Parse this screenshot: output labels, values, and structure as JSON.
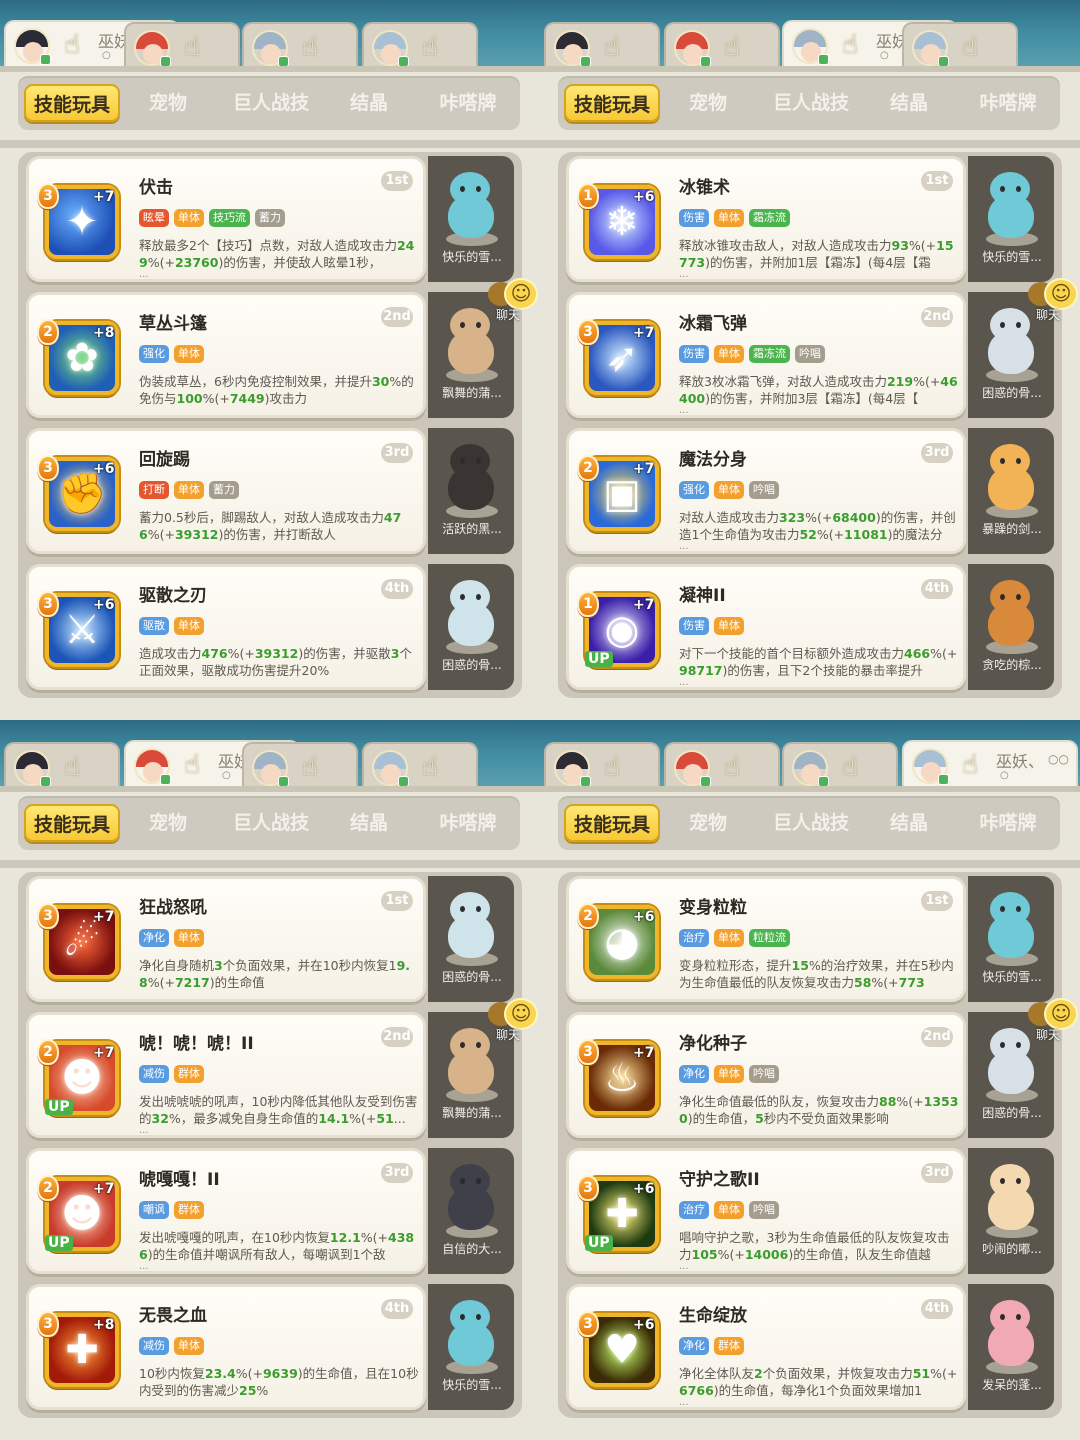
{
  "colors": {
    "tag_orange": "#f2a12f",
    "tag_green": "#4cb44f",
    "tag_blue": "#5a9be0",
    "tag_gray": "#a59d8e",
    "tag_red": "#e4572e",
    "highlight": "#3a9d2d",
    "nav_active": "#f7c935"
  },
  "panels": [
    {
      "active_tab": 0,
      "char_tabs": [
        {
          "name": "巫妖、",
          "dots": "○○",
          "sub": "○",
          "icon": "pointing-hand-icon"
        },
        {
          "name": "",
          "dots": "",
          "sub": "",
          "icon": "pointing-hand-icon"
        },
        {
          "name": "",
          "dots": "",
          "sub": "",
          "icon": "pointing-hand-icon"
        },
        {
          "name": "",
          "dots": "",
          "sub": "",
          "icon": "pointing-hand-icon"
        }
      ],
      "nav": [
        "技能玩具",
        "宠物",
        "巨人战技",
        "结晶",
        "咔嗒牌"
      ],
      "chat_label": "聊天",
      "cards": [
        {
          "title": "伏击",
          "rank": "1st",
          "level": "3",
          "plus": "+7",
          "up": "",
          "icon": "ambush-skill-icon",
          "tags": [
            [
              "眩晕",
              "red"
            ],
            [
              "单体",
              "orange"
            ],
            [
              "技巧流",
              "green"
            ],
            [
              "蓄力",
              "gray"
            ]
          ],
          "desc": [
            "释放最多2个【技巧】点数，对敌人造成攻击力",
            [
              "249",
              "%(+"
            ],
            [
              "23760",
              ")的伤害，并使敌人眩晕1秒，"
            ]
          ],
          "desc_plain": "",
          "more": "...",
          "pet": "快乐的雪..."
        },
        {
          "title": "草丛斗篷",
          "rank": "2nd",
          "level": "2",
          "plus": "+8",
          "up": "",
          "icon": "bush-cloak-skill-icon",
          "tags": [
            [
              "强化",
              "blue"
            ],
            [
              "单体",
              "orange"
            ]
          ],
          "desc": [
            "伪装成草丛，6秒内免疫控制效果，并提升",
            [
              "30",
              ""
            ],
            [
              "",
              "%的免伤与"
            ],
            [
              "100",
              "%(+"
            ],
            [
              "7449",
              ")攻击力"
            ]
          ],
          "more": "",
          "pet": "飘舞的蒲..."
        },
        {
          "title": "回旋踢",
          "rank": "3rd",
          "level": "3",
          "plus": "+6",
          "up": "",
          "icon": "spin-kick-skill-icon",
          "tags": [
            [
              "打断",
              "red"
            ],
            [
              "单体",
              "orange"
            ],
            [
              "蓄力",
              "gray"
            ]
          ],
          "desc": [
            "蓄力0.5秒后，脚踢敌人，对敌人造成攻击力",
            [
              "476",
              "%(+"
            ],
            [
              "39312",
              ")的伤害，并打断敌人"
            ]
          ],
          "more": "",
          "pet": "活跃的黑..."
        },
        {
          "title": "驱散之刃",
          "rank": "4th",
          "level": "3",
          "plus": "+6",
          "up": "",
          "icon": "dispel-blade-skill-icon",
          "tags": [
            [
              "驱散",
              "blue"
            ],
            [
              "单体",
              "orange"
            ]
          ],
          "desc": [
            "造成攻击力",
            [
              "476",
              "%(+"
            ],
            [
              "39312",
              ")的伤害，并驱散"
            ],
            [
              "3",
              "个正面效果，驱散成功伤害提升20%"
            ]
          ],
          "more": "",
          "pet": "困惑的骨..."
        }
      ]
    },
    {
      "active_tab": 2,
      "char_tabs": [
        {
          "name": "",
          "dots": "",
          "sub": "",
          "icon": "pointing-hand-icon"
        },
        {
          "name": "",
          "dots": "",
          "sub": "",
          "icon": "pointing-hand-icon"
        },
        {
          "name": "巫妖、",
          "dots": "○○",
          "sub": "○",
          "icon": "pointing-hand-icon"
        },
        {
          "name": "",
          "dots": "",
          "sub": "",
          "icon": "pointing-hand-icon"
        }
      ],
      "nav": [
        "技能玩具",
        "宠物",
        "巨人战技",
        "结晶",
        "咔嗒牌"
      ],
      "chat_label": "聊天",
      "cards": [
        {
          "title": "冰锥术",
          "rank": "1st",
          "level": "1",
          "plus": "+6",
          "up": "",
          "icon": "ice-cone-skill-icon",
          "tags": [
            [
              "伤害",
              "blue"
            ],
            [
              "单体",
              "orange"
            ],
            [
              "霜冻流",
              "green"
            ]
          ],
          "desc": [
            "释放冰锥攻击敌人，对敌人造成攻击力",
            [
              "93",
              "%(+"
            ],
            [
              "15773",
              ")的伤害，并附加1层【霜冻】(每4层【霜"
            ]
          ],
          "more": "...",
          "pet": "快乐的雪..."
        },
        {
          "title": "冰霜飞弹",
          "rank": "2nd",
          "level": "3",
          "plus": "+7",
          "up": "",
          "icon": "frost-missile-skill-icon",
          "tags": [
            [
              "伤害",
              "blue"
            ],
            [
              "单体",
              "orange"
            ],
            [
              "霜冻流",
              "green"
            ],
            [
              "吟唱",
              "gray"
            ]
          ],
          "desc": [
            "释放3枚冰霜飞弹，对敌人造成攻击力",
            [
              "219",
              "%(+"
            ],
            [
              "46400",
              ")的伤害，并附加3层【霜冻】(每4层【"
            ]
          ],
          "more": "...",
          "pet": "困惑的骨..."
        },
        {
          "title": "魔法分身",
          "rank": "3rd",
          "level": "2",
          "plus": "+7",
          "up": "",
          "icon": "magic-clone-skill-icon",
          "tags": [
            [
              "强化",
              "blue"
            ],
            [
              "单体",
              "orange"
            ],
            [
              "吟唱",
              "gray"
            ]
          ],
          "desc": [
            "对敌人造成攻击力",
            [
              "323",
              "%(+"
            ],
            [
              "68400",
              ")的伤害，并创造1个生命值为攻击力"
            ],
            [
              "52",
              "%(+"
            ],
            [
              "11081",
              ")的魔法分"
            ]
          ],
          "more": "...",
          "pet": "暴躁的剑..."
        },
        {
          "title": "凝神II",
          "rank": "4th",
          "level": "1",
          "plus": "+7",
          "up": "UP",
          "icon": "focus-skill-icon",
          "tags": [
            [
              "伤害",
              "blue"
            ],
            [
              "单体",
              "orange"
            ]
          ],
          "desc": [
            "对下一个技能的首个目标额外造成攻击力",
            [
              "466",
              "%(+"
            ],
            [
              "98717",
              ")的伤害，且下2个技能的暴击率提升"
            ]
          ],
          "more": "...",
          "pet": "贪吃的棕..."
        }
      ]
    },
    {
      "active_tab": 1,
      "char_tabs": [
        {
          "name": "",
          "dots": "",
          "sub": "",
          "icon": "pointing-hand-icon"
        },
        {
          "name": "巫妖、",
          "dots": "○○",
          "sub": "○",
          "icon": "pointing-hand-icon"
        },
        {
          "name": "",
          "dots": "",
          "sub": "",
          "icon": "pointing-hand-icon"
        },
        {
          "name": "",
          "dots": "",
          "sub": "",
          "icon": "pointing-hand-icon"
        }
      ],
      "nav": [
        "技能玩具",
        "宠物",
        "巨人战技",
        "结晶",
        "咔嗒牌"
      ],
      "chat_label": "聊天",
      "cards": [
        {
          "title": "狂战怒吼",
          "rank": "1st",
          "level": "3",
          "plus": "+7",
          "up": "",
          "icon": "berserk-roar-skill-icon",
          "tags": [
            [
              "净化",
              "blue"
            ],
            [
              "单体",
              "orange"
            ]
          ],
          "desc": [
            "净化自身随机",
            [
              "3",
              "个负面效果，并在10秒内恢复1"
            ],
            [
              "9.8",
              "%(+"
            ],
            [
              "7217",
              ")的生命值"
            ]
          ],
          "more": "",
          "pet": "困惑的骨..."
        },
        {
          "title": "唬！唬！唬！II",
          "rank": "2nd",
          "level": "2",
          "plus": "+7",
          "up": "UP",
          "icon": "roar-skill-icon",
          "tags": [
            [
              "减伤",
              "blue"
            ],
            [
              "群体",
              "orange"
            ]
          ],
          "desc": [
            "发出唬唬唬的吼声，10秒内降低其他队友受到伤害的",
            [
              "32",
              "%，最多减免自身生命值的"
            ],
            [
              "14.1",
              "%(+"
            ],
            [
              "51",
              "..."
            ]
          ],
          "more": "...",
          "pet": "飘舞的蒲..."
        },
        {
          "title": "唬嘎嘎！II",
          "rank": "3rd",
          "level": "2",
          "plus": "+7",
          "up": "UP",
          "icon": "taunt-roar-skill-icon",
          "tags": [
            [
              "嘲讽",
              "blue"
            ],
            [
              "群体",
              "orange"
            ]
          ],
          "desc": [
            "发出唬嘎嘎的吼声，在10秒内恢复",
            [
              "12.1",
              "%(+"
            ],
            [
              "4386",
              ")的生命值并嘲讽所有敌人，每嘲讽到1个敌"
            ]
          ],
          "more": "...",
          "pet": "自信的大..."
        },
        {
          "title": "无畏之血",
          "rank": "4th",
          "level": "3",
          "plus": "+8",
          "up": "",
          "icon": "fearless-blood-skill-icon",
          "tags": [
            [
              "减伤",
              "blue"
            ],
            [
              "单体",
              "orange"
            ]
          ],
          "desc": [
            "10秒内恢复",
            [
              "23.4",
              "%(+"
            ],
            [
              "9639",
              ")的生命值，且在10秒内受到的伤害减少"
            ],
            [
              "25",
              "%"
            ]
          ],
          "more": "",
          "pet": "快乐的雪..."
        }
      ]
    },
    {
      "active_tab": 3,
      "char_tabs": [
        {
          "name": "",
          "dots": "",
          "sub": "",
          "icon": "pointing-hand-icon"
        },
        {
          "name": "",
          "dots": "",
          "sub": "",
          "icon": "pointing-hand-icon"
        },
        {
          "name": "",
          "dots": "",
          "sub": "",
          "icon": "pointing-hand-icon"
        },
        {
          "name": "巫妖、",
          "dots": "○○",
          "sub": "○",
          "icon": "pointing-hand-icon"
        }
      ],
      "nav": [
        "技能玩具",
        "宠物",
        "巨人战技",
        "结晶",
        "咔嗒牌"
      ],
      "chat_label": "聊天",
      "cards": [
        {
          "title": "变身粒粒",
          "rank": "1st",
          "level": "2",
          "plus": "+6",
          "up": "",
          "icon": "transform-seed-skill-icon",
          "tags": [
            [
              "治疗",
              "blue"
            ],
            [
              "单体",
              "orange"
            ],
            [
              "粒粒流",
              "green"
            ]
          ],
          "desc": [
            "变身粒粒形态，提升",
            [
              "15",
              "%的治疗效果，并在5秒内为生命值最低的队友恢复攻击力"
            ],
            [
              "58",
              "%(+"
            ],
            [
              "773",
              ""
            ]
          ],
          "more": "",
          "pet": "快乐的雪..."
        },
        {
          "title": "净化种子",
          "rank": "2nd",
          "level": "3",
          "plus": "+7",
          "up": "",
          "icon": "purify-seed-skill-icon",
          "tags": [
            [
              "净化",
              "blue"
            ],
            [
              "单体",
              "orange"
            ],
            [
              "吟唱",
              "gray"
            ]
          ],
          "desc": [
            "净化生命值最低的队友，恢复攻击力",
            [
              "88",
              "%(+"
            ],
            [
              "13530",
              ")的生命值，"
            ],
            [
              "5",
              "秒内不受负面效果影响"
            ]
          ],
          "more": "",
          "pet": "困惑的骨..."
        },
        {
          "title": "守护之歌II",
          "rank": "3rd",
          "level": "3",
          "plus": "+6",
          "up": "UP",
          "icon": "guardian-song-skill-icon",
          "tags": [
            [
              "治疗",
              "blue"
            ],
            [
              "单体",
              "orange"
            ],
            [
              "吟唱",
              "gray"
            ]
          ],
          "desc": [
            "唱响守护之歌，3秒为生命值最低的队友恢复攻击力",
            [
              "105",
              "%(+"
            ],
            [
              "14006",
              ")的生命值，队友生命值越"
            ]
          ],
          "more": "...",
          "pet": "吵闹的嘟..."
        },
        {
          "title": "生命绽放",
          "rank": "4th",
          "level": "3",
          "plus": "+6",
          "up": "",
          "icon": "life-bloom-skill-icon",
          "tags": [
            [
              "净化",
              "blue"
            ],
            [
              "群体",
              "orange"
            ]
          ],
          "desc": [
            "净化全体队友",
            [
              "2",
              "个负面效果，并恢复攻击力"
            ],
            [
              "51",
              "%(+"
            ],
            [
              "6766",
              ")的生命值，每净化1个负面效果增加1"
            ]
          ],
          "more": "...",
          "pet": "发呆的蓬..."
        }
      ]
    }
  ]
}
